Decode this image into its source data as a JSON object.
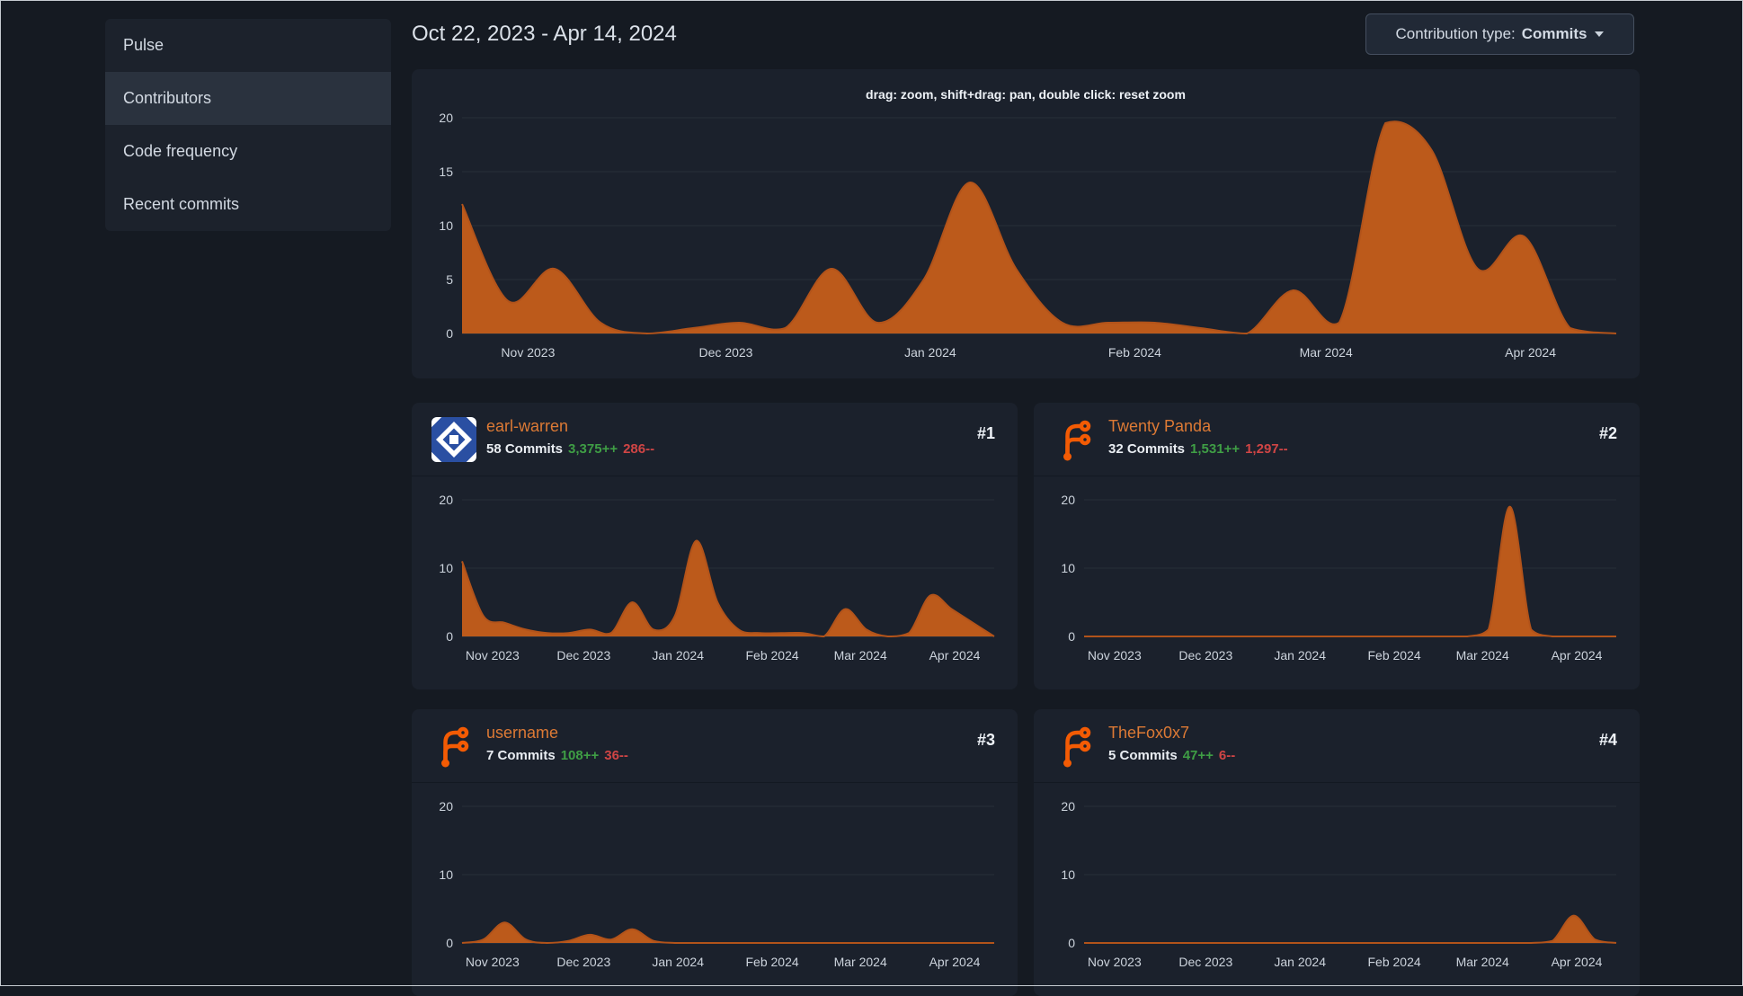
{
  "header": {
    "date_range": "Oct 22, 2023 - Apr 14, 2024",
    "contribution_type": {
      "label": "Contribution type:",
      "value": "Commits"
    }
  },
  "sidebar": {
    "items": [
      {
        "label": "Pulse",
        "active": false
      },
      {
        "label": "Contributors",
        "active": true
      },
      {
        "label": "Code frequency",
        "active": false
      },
      {
        "label": "Recent commits",
        "active": false
      }
    ]
  },
  "main_chart": {
    "hint": "drag: zoom, shift+drag: pan, double click: reset zoom"
  },
  "contributors": [
    {
      "rank": "#1",
      "name": "earl-warren",
      "commits": "58 Commits",
      "additions": "3,375++",
      "deletions": "286--",
      "avatar": "identicon"
    },
    {
      "rank": "#2",
      "name": "Twenty Panda",
      "commits": "32 Commits",
      "additions": "1,531++",
      "deletions": "1,297--",
      "avatar": "forgejo-logo"
    },
    {
      "rank": "#3",
      "name": "username",
      "commits": "7 Commits",
      "additions": "108++",
      "deletions": "36--",
      "avatar": "forgejo-logo"
    },
    {
      "rank": "#4",
      "name": "TheFox0x7",
      "commits": "5 Commits",
      "additions": "47++",
      "deletions": "6--",
      "avatar": "forgejo-logo"
    }
  ],
  "colors": {
    "chart_orange": "#bc5a1b",
    "additions_green": "#3f9e45",
    "deletions_red": "#d04545",
    "name_link_orange": "#dd7a35"
  },
  "chart_data": {
    "type": "area",
    "x_weekly_dates": [
      "2023-10-22",
      "2023-10-29",
      "2023-11-05",
      "2023-11-12",
      "2023-11-19",
      "2023-11-26",
      "2023-12-03",
      "2023-12-10",
      "2023-12-17",
      "2023-12-24",
      "2023-12-31",
      "2024-01-07",
      "2024-01-14",
      "2024-01-21",
      "2024-01-28",
      "2024-02-04",
      "2024-02-11",
      "2024-02-18",
      "2024-02-25",
      "2024-03-03",
      "2024-03-10",
      "2024-03-17",
      "2024-03-24",
      "2024-03-31",
      "2024-04-07",
      "2024-04-14"
    ],
    "x_axis_labels": [
      "Nov 2023",
      "Dec 2023",
      "Jan 2024",
      "Feb 2024",
      "Mar 2024",
      "Apr 2024"
    ],
    "x_label_dates": [
      "2023-11-01",
      "2023-12-01",
      "2024-01-01",
      "2024-02-01",
      "2024-03-01",
      "2024-04-01"
    ],
    "y_max": 20,
    "y_ticks_main": [
      0,
      5,
      10,
      15,
      20
    ],
    "y_ticks_small": [
      0,
      10,
      20
    ],
    "color": "#bc5a1b",
    "line_color": "#b2531a",
    "grid_color": "#272e39",
    "axis_line_color": "#323b48",
    "series": [
      {
        "name": "total",
        "values": [
          12,
          3,
          6,
          1,
          0,
          0.5,
          1,
          0.5,
          6,
          1,
          5,
          14,
          6,
          1,
          1,
          1,
          0.5,
          0,
          4,
          1,
          19.5,
          17,
          6,
          9,
          0.5,
          0
        ]
      },
      {
        "name": "earl-warren",
        "values": [
          11,
          3,
          2,
          1,
          0.5,
          0.5,
          1,
          0.5,
          5,
          1,
          3,
          14,
          5,
          1,
          0.5,
          0.5,
          0.5,
          0,
          4,
          1,
          0,
          0.5,
          6,
          4,
          2,
          0
        ]
      },
      {
        "name": "Twenty Panda",
        "values": [
          0,
          0,
          0,
          0,
          0,
          0,
          0,
          0,
          0,
          0,
          0,
          0,
          0,
          0,
          0,
          0,
          0,
          0,
          0,
          1,
          19,
          1,
          0,
          0,
          0,
          0
        ]
      },
      {
        "name": "username",
        "values": [
          0,
          0.5,
          3,
          0.5,
          0,
          0.3,
          1.2,
          0.5,
          2,
          0.3,
          0,
          0,
          0,
          0,
          0,
          0,
          0,
          0,
          0,
          0,
          0,
          0,
          0,
          0,
          0,
          0
        ]
      },
      {
        "name": "TheFox0x7",
        "values": [
          0,
          0,
          0,
          0,
          0,
          0,
          0,
          0,
          0,
          0,
          0,
          0,
          0,
          0,
          0,
          0,
          0,
          0,
          0,
          0,
          0,
          0,
          0.3,
          4,
          0.5,
          0
        ]
      }
    ]
  }
}
